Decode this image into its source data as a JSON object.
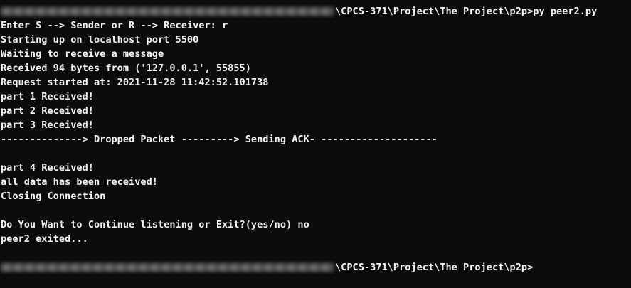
{
  "window": {
    "background": "#0c0c0c",
    "text_color": "#f2f2f2"
  },
  "lines": [
    {
      "redacted_prefix": true,
      "text": "\\CPCS-371\\Project\\The Project\\p2p>py peer2.py"
    },
    {
      "text": "Enter S --> Sender or R --> Receiver: r"
    },
    {
      "text": "Starting up on localhost port 5500"
    },
    {
      "text": "Waiting to receive a message"
    },
    {
      "text": "Received 94 bytes from ('127.0.0.1', 55855)"
    },
    {
      "text": "Request started at: 2021-11-28 11:42:52.101738"
    },
    {
      "text": "part 1 Received!"
    },
    {
      "text": "part 2 Received!"
    },
    {
      "text": "part 3 Received!"
    },
    {
      "text": "--------------> Dropped Packet ---------> Sending ACK- --------------------"
    },
    {
      "text": ""
    },
    {
      "text": "part 4 Received!"
    },
    {
      "text": "all data has been received!"
    },
    {
      "text": "Closing Connection"
    },
    {
      "text": ""
    },
    {
      "text": "Do You Want to Continue listening or Exit?(yes/no) no"
    },
    {
      "text": "peer2 exited..."
    },
    {
      "text": ""
    },
    {
      "redacted_prefix": true,
      "text": "\\CPCS-371\\Project\\The Project\\p2p>"
    }
  ]
}
